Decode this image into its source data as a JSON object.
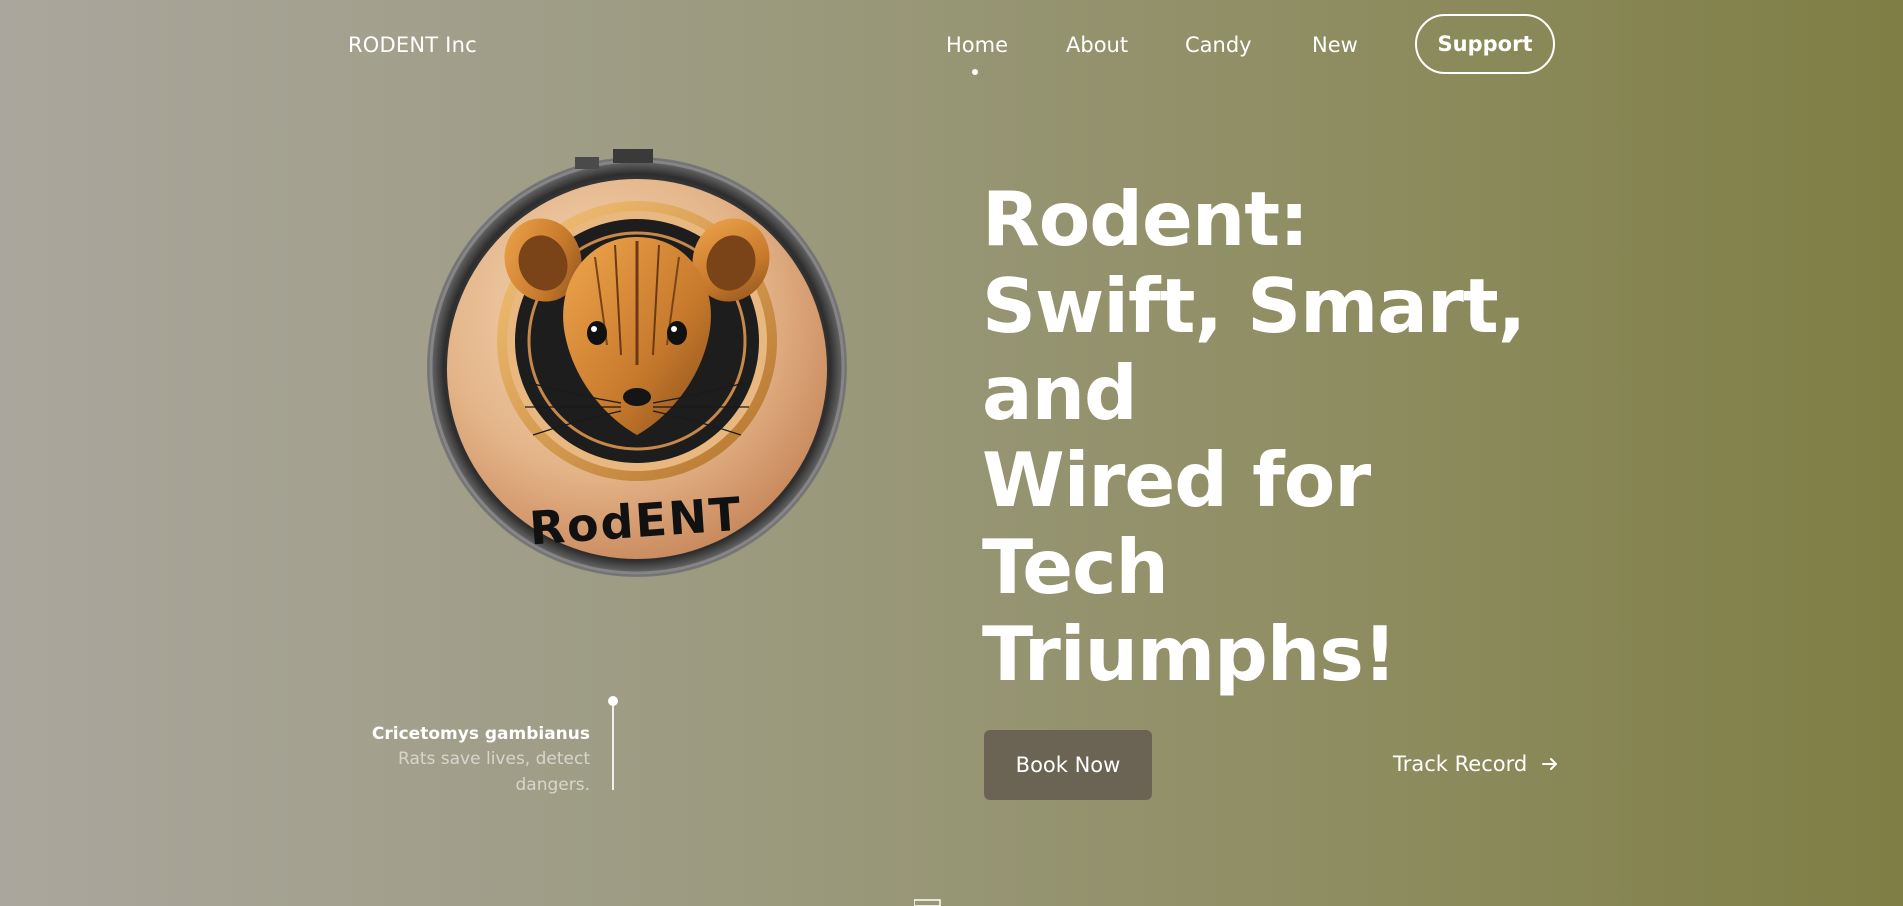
{
  "brand": "RODENT Inc",
  "nav": {
    "items": [
      "Home",
      "About",
      "Candy",
      "New"
    ],
    "active": "Home",
    "support_label": "Support"
  },
  "logo": {
    "text": "RodENT",
    "icon": "rodent-badge-logo"
  },
  "hero": {
    "headline_lines": [
      "Rodent:",
      "Swift, Smart,",
      "and",
      "Wired for",
      "Tech",
      "Triumphs!"
    ],
    "book_label": "Book Now",
    "track_label": "Track Record"
  },
  "caption": {
    "title": "Cricetomys gambianus",
    "text": "Rats save lives, detect dangers."
  },
  "colors": {
    "background_left": "#aaa69d",
    "background_right": "#7f7e45",
    "button_bg": "#6b6454",
    "text": "#ffffff"
  }
}
